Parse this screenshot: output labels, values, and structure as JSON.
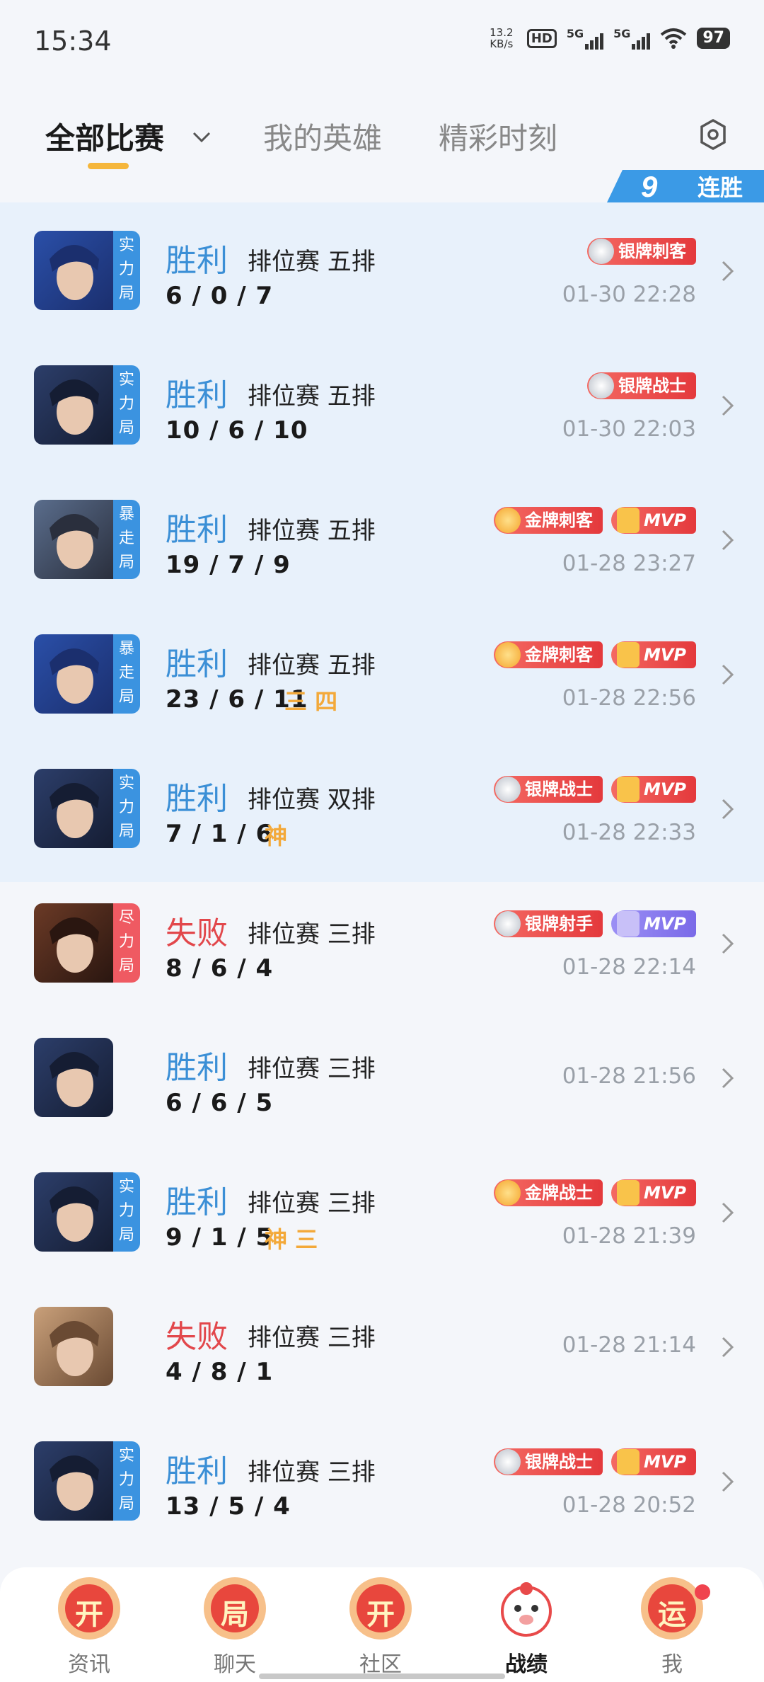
{
  "status_bar": {
    "time": "15:34",
    "speed_value": "13.2",
    "speed_unit": "KB/s",
    "hd_label": "HD",
    "net1": "5G",
    "net2": "5G",
    "battery": "97"
  },
  "tabs": {
    "items": [
      {
        "label": "全部比赛",
        "active": true
      },
      {
        "label": "我的英雄",
        "active": false
      },
      {
        "label": "精彩时刻",
        "active": false
      }
    ]
  },
  "streak": {
    "count": "9",
    "label": "连胜"
  },
  "colors": {
    "win": "#3b8fd6",
    "loss": "#e2474b",
    "tag_blue": "#3b93e0",
    "tag_red": "#ef5a62",
    "accent_yellow": "#f5b63b"
  },
  "matches": [
    {
      "result": "胜利",
      "win": true,
      "mode": "排位赛 五排",
      "kda": "6 / 0 / 7",
      "extra": "",
      "time": "01-30 22:28",
      "tag": [
        "实",
        "力",
        "局"
      ],
      "tag_color": "blue",
      "badges": [
        {
          "text": "银牌刺客",
          "medal": "silver"
        }
      ],
      "face": "blue-hair"
    },
    {
      "result": "胜利",
      "win": true,
      "mode": "排位赛 五排",
      "kda": "10 / 6 / 10",
      "extra": "",
      "time": "01-30 22:03",
      "tag": [
        "实",
        "力",
        "局"
      ],
      "tag_color": "blue",
      "badges": [
        {
          "text": "银牌战士",
          "medal": "silver"
        }
      ],
      "face": "dark-hair"
    },
    {
      "result": "胜利",
      "win": true,
      "mode": "排位赛 五排",
      "kda": "19 / 7 / 9",
      "extra": "",
      "time": "01-28 23:27",
      "tag": [
        "暴",
        "走",
        "局"
      ],
      "tag_color": "blue",
      "badges": [
        {
          "text": "金牌刺客",
          "medal": "gold"
        },
        {
          "text": "MVP",
          "mvp": true
        }
      ],
      "face": "masked"
    },
    {
      "result": "胜利",
      "win": true,
      "mode": "排位赛 五排",
      "kda": "23 / 6 / 11",
      "extra": "三  四",
      "time": "01-28 22:56",
      "tag": [
        "暴",
        "走",
        "局"
      ],
      "tag_color": "blue",
      "badges": [
        {
          "text": "金牌刺客",
          "medal": "gold"
        },
        {
          "text": "MVP",
          "mvp": true
        }
      ],
      "face": "blue-hair"
    },
    {
      "result": "胜利",
      "win": true,
      "mode": "排位赛 双排",
      "kda": "7 / 1 / 6",
      "extra": "神",
      "time": "01-28 22:33",
      "tag": [
        "实",
        "力",
        "局"
      ],
      "tag_color": "blue",
      "badges": [
        {
          "text": "银牌战士",
          "medal": "silver"
        },
        {
          "text": "MVP",
          "mvp": true
        }
      ],
      "face": "dark-hair"
    },
    {
      "result": "失败",
      "win": false,
      "mode": "排位赛 三排",
      "kda": "8 / 6 / 4",
      "extra": "",
      "time": "01-28 22:14",
      "tag": [
        "尽",
        "力",
        "局"
      ],
      "tag_color": "red",
      "badges": [
        {
          "text": "银牌射手",
          "medal": "silver"
        },
        {
          "text": "MVP",
          "mvp": true,
          "purple": true
        }
      ],
      "face": "hat"
    },
    {
      "result": "胜利",
      "win": true,
      "mode": "排位赛 三排",
      "kda": "6 / 6 / 5",
      "extra": "",
      "time": "01-28 21:56",
      "tag": [],
      "tag_color": "",
      "badges": [],
      "face": "dark-hair"
    },
    {
      "result": "胜利",
      "win": true,
      "mode": "排位赛 三排",
      "kda": "9 / 1 / 5",
      "extra": "神  三",
      "time": "01-28 21:39",
      "tag": [
        "实",
        "力",
        "局"
      ],
      "tag_color": "blue",
      "badges": [
        {
          "text": "金牌战士",
          "medal": "gold"
        },
        {
          "text": "MVP",
          "mvp": true
        }
      ],
      "face": "dark-hair"
    },
    {
      "result": "失败",
      "win": false,
      "mode": "排位赛 三排",
      "kda": "4 / 8 / 1",
      "extra": "",
      "time": "01-28 21:14",
      "tag": [],
      "tag_color": "",
      "badges": [],
      "face": "brown-hair"
    },
    {
      "result": "胜利",
      "win": true,
      "mode": "排位赛 三排",
      "kda": "13 / 5 / 4",
      "extra": "",
      "time": "01-28 20:52",
      "tag": [
        "实",
        "力",
        "局"
      ],
      "tag_color": "blue",
      "badges": [
        {
          "text": "银牌战士",
          "medal": "silver"
        },
        {
          "text": "MVP",
          "mvp": true
        }
      ],
      "face": "dark-hair"
    }
  ],
  "bottom_nav": [
    {
      "label": "资讯",
      "icon_text": "开",
      "active": false
    },
    {
      "label": "聊天",
      "icon_text": "局",
      "active": false
    },
    {
      "label": "社区",
      "icon_text": "开",
      "active": false
    },
    {
      "label": "战绩",
      "icon_text": "",
      "active": true
    },
    {
      "label": "我",
      "icon_text": "运",
      "active": false,
      "dot": true
    }
  ]
}
